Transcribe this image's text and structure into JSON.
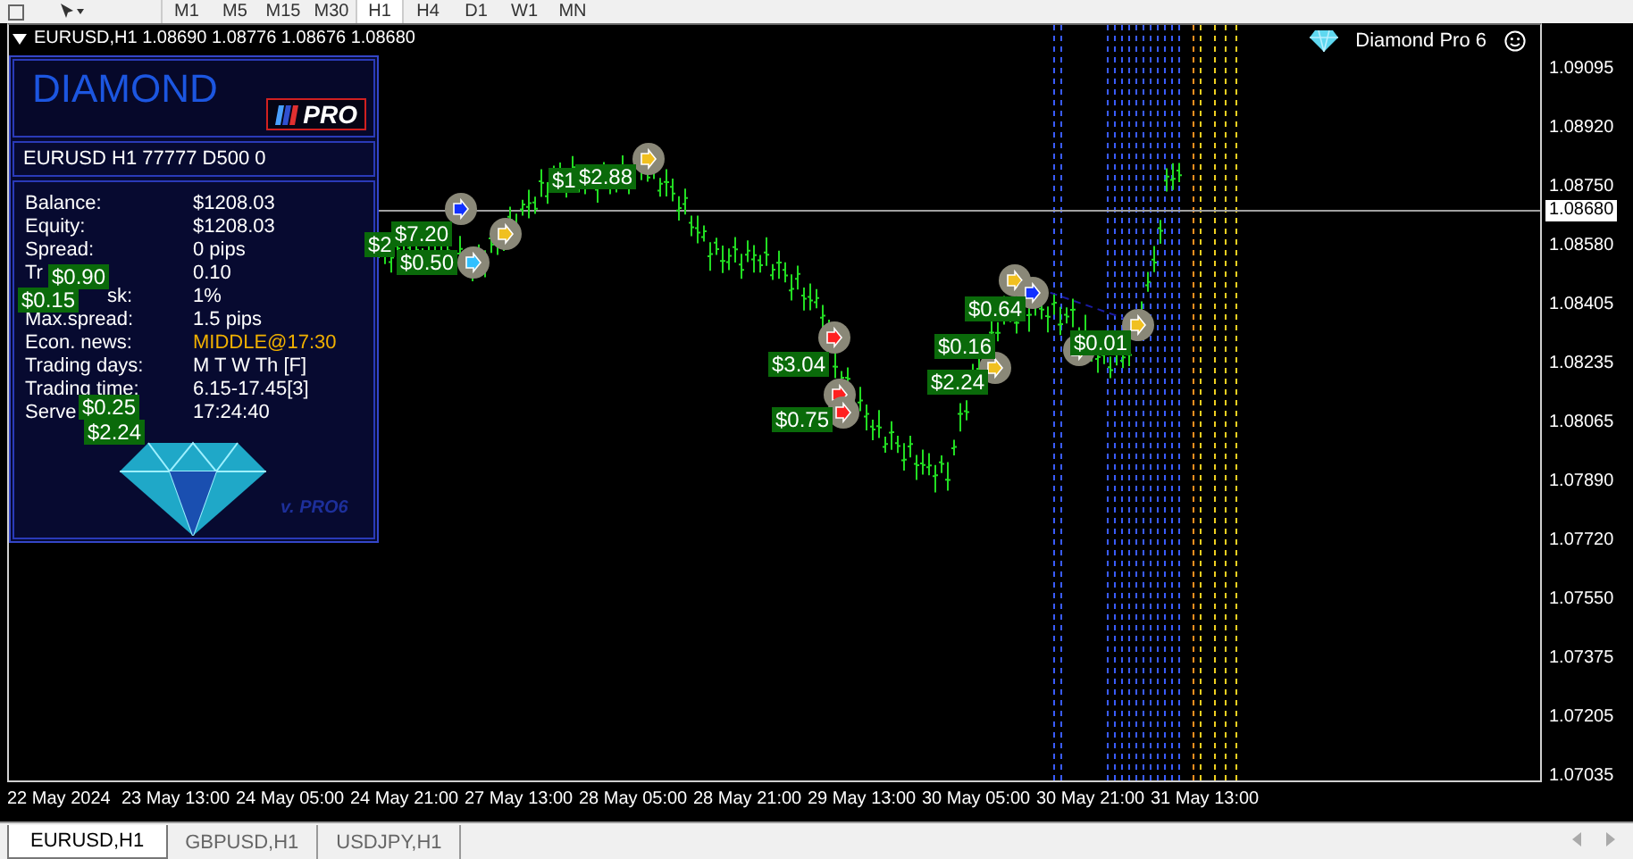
{
  "toolbar": {
    "timeframes": [
      {
        "label": "M1",
        "selected": false
      },
      {
        "label": "M5",
        "selected": false
      },
      {
        "label": "M15",
        "selected": false
      },
      {
        "label": "M30",
        "selected": false
      },
      {
        "label": "H1",
        "selected": true
      },
      {
        "label": "H4",
        "selected": false
      },
      {
        "label": "D1",
        "selected": false
      },
      {
        "label": "W1",
        "selected": false
      },
      {
        "label": "MN",
        "selected": false
      }
    ]
  },
  "chart": {
    "header": "EURUSD,H1  1.08690 1.08776 1.08676 1.08680",
    "indicator_name": "Diamond Pro 6",
    "price_axis": [
      "1.09095",
      "1.08920",
      "1.08750",
      "1.08580",
      "1.08405",
      "1.08235",
      "1.08065",
      "1.07890",
      "1.07720",
      "1.07550",
      "1.07375",
      "1.07205",
      "1.07035"
    ],
    "current_price": "1.08680",
    "time_axis": [
      "22 May 2024",
      "23 May 13:00",
      "24 May 05:00",
      "24 May 21:00",
      "27 May 13:00",
      "28 May 05:00",
      "28 May 21:00",
      "29 May 13:00",
      "30 May 05:00",
      "30 May 21:00",
      "31 May 13:00"
    ],
    "profit_labels": [
      "$1",
      "$2.88",
      "$2",
      "$7.20",
      "$0.50",
      "$0.90",
      "$0.15",
      "$3.04",
      "$0.75",
      "$0.64",
      "$0.16",
      "$2.24",
      "$0.01",
      "$0.25",
      "$2.24"
    ]
  },
  "panel": {
    "logo": "DIAMOND",
    "badge": "PRO",
    "account": "EURUSD H1 77777  D500 0",
    "rows": [
      {
        "label": "Balance:",
        "value": "$1208.03",
        "kind": "normal"
      },
      {
        "label": "Equity:",
        "value": "$1208.03",
        "kind": "normal"
      },
      {
        "label": "Spread:",
        "value": "0 pips",
        "kind": "normal"
      },
      {
        "label": "Tr",
        "value": "0.10",
        "kind": "normal"
      },
      {
        "label": "sk:",
        "value": "1%",
        "kind": "normal"
      },
      {
        "label": "Max.spread:",
        "value": "1.5 pips",
        "kind": "normal"
      },
      {
        "label": "Econ. news:",
        "value": "MIDDLE@17:30",
        "kind": "highlight"
      },
      {
        "label": "Trading days:",
        "value": "M T W Th [F]",
        "kind": "normal"
      },
      {
        "label": "Trading time:",
        "value": "6.15-17.45[3]",
        "kind": "normal"
      },
      {
        "label": "Serve",
        "value": "17:24:40",
        "kind": "normal"
      }
    ],
    "version": "v. PRO6"
  },
  "tabs": [
    {
      "label": "EURUSD,H1",
      "selected": true
    },
    {
      "label": "GBPUSD,H1",
      "selected": false
    },
    {
      "label": "USDJPY,H1",
      "selected": false
    }
  ]
}
